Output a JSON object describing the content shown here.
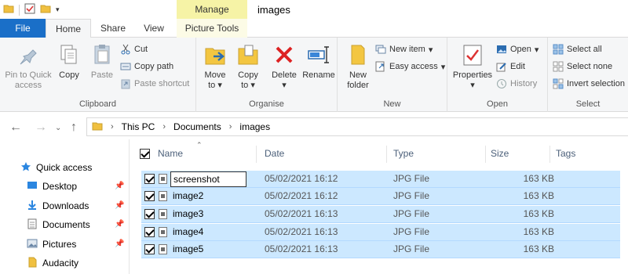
{
  "window": {
    "title": "images",
    "manage_label": "Manage"
  },
  "tabs": {
    "file": "File",
    "home": "Home",
    "share": "Share",
    "view": "View",
    "picture_tools": "Picture Tools"
  },
  "ribbon": {
    "clipboard": {
      "label": "Clipboard",
      "pin": "Pin to Quick\naccess",
      "pin_line1": "Pin to Quick",
      "pin_line2": "access",
      "copy": "Copy",
      "paste": "Paste",
      "cut": "Cut",
      "copy_path": "Copy path",
      "paste_shortcut": "Paste shortcut"
    },
    "organise": {
      "label": "Organise",
      "move_to": "Move",
      "move_to2": "to",
      "copy_to": "Copy",
      "copy_to2": "to",
      "delete": "Delete",
      "rename": "Rename"
    },
    "new": {
      "label": "New",
      "new_folder": "New",
      "new_folder2": "folder",
      "new_item": "New item",
      "easy_access": "Easy access"
    },
    "open": {
      "label": "Open",
      "properties": "Properties",
      "open": "Open",
      "edit": "Edit",
      "history": "History"
    },
    "select": {
      "label": "Select",
      "select_all": "Select all",
      "select_none": "Select none",
      "invert": "Invert selection"
    }
  },
  "address": {
    "crumbs": [
      "This PC",
      "Documents",
      "images"
    ]
  },
  "navpane": {
    "items": [
      {
        "label": "Quick access",
        "icon": "star-icon",
        "pinned": false
      },
      {
        "label": "Desktop",
        "icon": "desktop-icon",
        "pinned": true
      },
      {
        "label": "Downloads",
        "icon": "download-icon",
        "pinned": true
      },
      {
        "label": "Documents",
        "icon": "documents-icon",
        "pinned": true
      },
      {
        "label": "Pictures",
        "icon": "pictures-icon",
        "pinned": true
      },
      {
        "label": "Audacity",
        "icon": "folder-icon",
        "pinned": false
      }
    ]
  },
  "columns": {
    "name": "Name",
    "date": "Date",
    "type": "Type",
    "size": "Size",
    "tags": "Tags"
  },
  "files": [
    {
      "name": "screenshot",
      "date": "05/02/2021 16:12",
      "type": "JPG File",
      "size": "163 KB",
      "renaming": true
    },
    {
      "name": "image2",
      "date": "05/02/2021 16:12",
      "type": "JPG File",
      "size": "163 KB",
      "renaming": false
    },
    {
      "name": "image3",
      "date": "05/02/2021 16:13",
      "type": "JPG File",
      "size": "163 KB",
      "renaming": false
    },
    {
      "name": "image4",
      "date": "05/02/2021 16:13",
      "type": "JPG File",
      "size": "163 KB",
      "renaming": false
    },
    {
      "name": "image5",
      "date": "05/02/2021 16:13",
      "type": "JPG File",
      "size": "163 KB",
      "renaming": false
    }
  ],
  "colors": {
    "file_tab": "#1a6fc8",
    "selection": "#cce8ff",
    "manage_tab": "#f6f3a6"
  }
}
